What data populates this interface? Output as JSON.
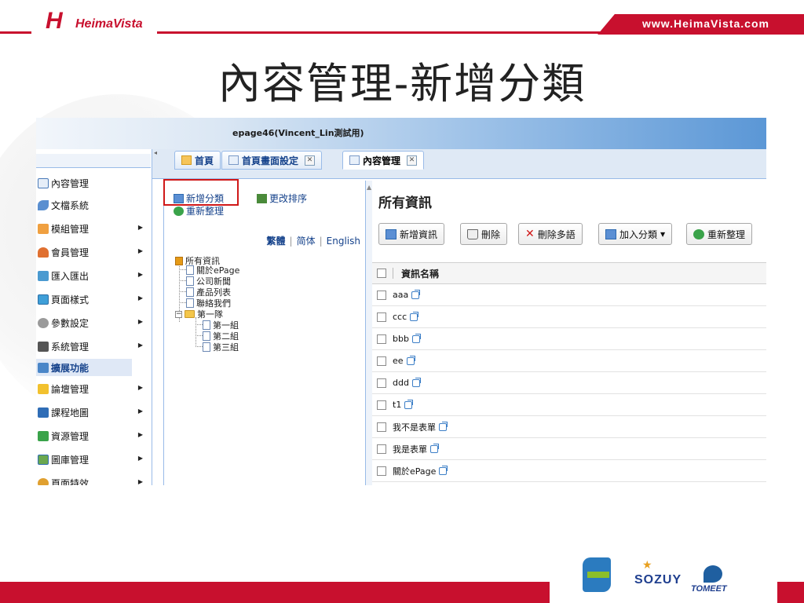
{
  "header": {
    "brand": "HeimaVista",
    "brand_mark": "H",
    "url": "www.HeimaVista.com",
    "title": "內容管理-新增分類"
  },
  "app": {
    "title": "epage46(Vincent_Lin測試用)",
    "tabs": [
      {
        "label": "首頁",
        "icon": "home-icon"
      },
      {
        "label": "首頁畫面設定",
        "icon": "page-icon"
      },
      {
        "label": "內容管理",
        "icon": "content-icon",
        "active": true
      }
    ],
    "nav": [
      {
        "label": "內容管理",
        "icon": "content-icon"
      },
      {
        "label": "文檔系統",
        "icon": "document-icon"
      },
      {
        "label": "模組管理",
        "icon": "module-icon"
      },
      {
        "label": "會員管理",
        "icon": "member-icon"
      },
      {
        "label": "匯入匯出",
        "icon": "import-export-icon"
      },
      {
        "label": "頁面樣式",
        "icon": "style-icon"
      },
      {
        "label": "參數設定",
        "icon": "gear-icon"
      },
      {
        "label": "系統管理",
        "icon": "system-icon"
      },
      {
        "label": "擴展功能",
        "icon": "extension-icon",
        "highlight": true
      },
      {
        "label": "論壇管理",
        "icon": "forum-icon"
      },
      {
        "label": "課程地圖",
        "icon": "course-map-icon"
      },
      {
        "label": "資源管理",
        "icon": "resource-icon"
      },
      {
        "label": "圖庫管理",
        "icon": "gallery-icon"
      },
      {
        "label": "頁面特效",
        "icon": "effect-icon"
      }
    ],
    "category_panel": {
      "add_category": "新增分類",
      "change_order": "更改排序",
      "refresh": "重新整理",
      "lang_trad": "繁體",
      "lang_simp": "简体",
      "lang_en": "English",
      "tree": {
        "root": "所有資訊",
        "children": [
          "關於ePage",
          "公司新聞",
          "產品列表",
          "聯絡我們"
        ],
        "group": "第一隊",
        "group_children": [
          "第一組",
          "第二組",
          "第三組"
        ]
      }
    },
    "main": {
      "title": "所有資訊",
      "toolbar": {
        "add_info": "新增資訊",
        "delete": "刪除",
        "delete_multi": "刪除多語",
        "add_to_category": "加入分類",
        "refresh": "重新整理"
      },
      "column_name": "資訊名稱",
      "rows": [
        "aaa",
        "ccc",
        "bbb",
        "ee",
        "ddd",
        "t1",
        "我不是表單",
        "我是表單",
        "關於ePage"
      ]
    }
  },
  "footer": {
    "logo2": "SOZUY",
    "logo3": "TOMEET"
  },
  "colors": {
    "brand_red": "#c8102e",
    "header_blue": "#5b97d6",
    "ext_blue": "#15428b"
  }
}
